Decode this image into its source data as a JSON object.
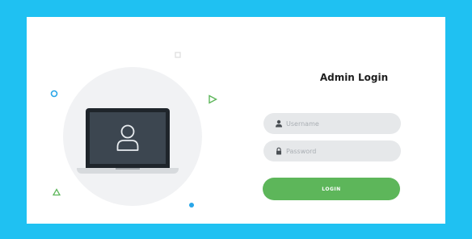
{
  "login": {
    "title": "Admin Login",
    "username": {
      "value": "",
      "placeholder": "Username",
      "icon": "user-icon"
    },
    "password": {
      "value": "",
      "placeholder": "Password",
      "icon": "lock-icon"
    },
    "button_label": "LOGIN"
  },
  "colors": {
    "page_background": "#1fc1f2",
    "card_background": "#ffffff",
    "field_background": "#e6e8ea",
    "button": "#5db65a",
    "accent_blue": "#29a6e8",
    "accent_green": "#5db65a"
  },
  "illustration": {
    "icons": [
      "laptop-icon",
      "user-avatar-icon",
      "circle-shape",
      "square-shape",
      "triangle-shape",
      "triangle-shape",
      "dot-shape"
    ]
  }
}
